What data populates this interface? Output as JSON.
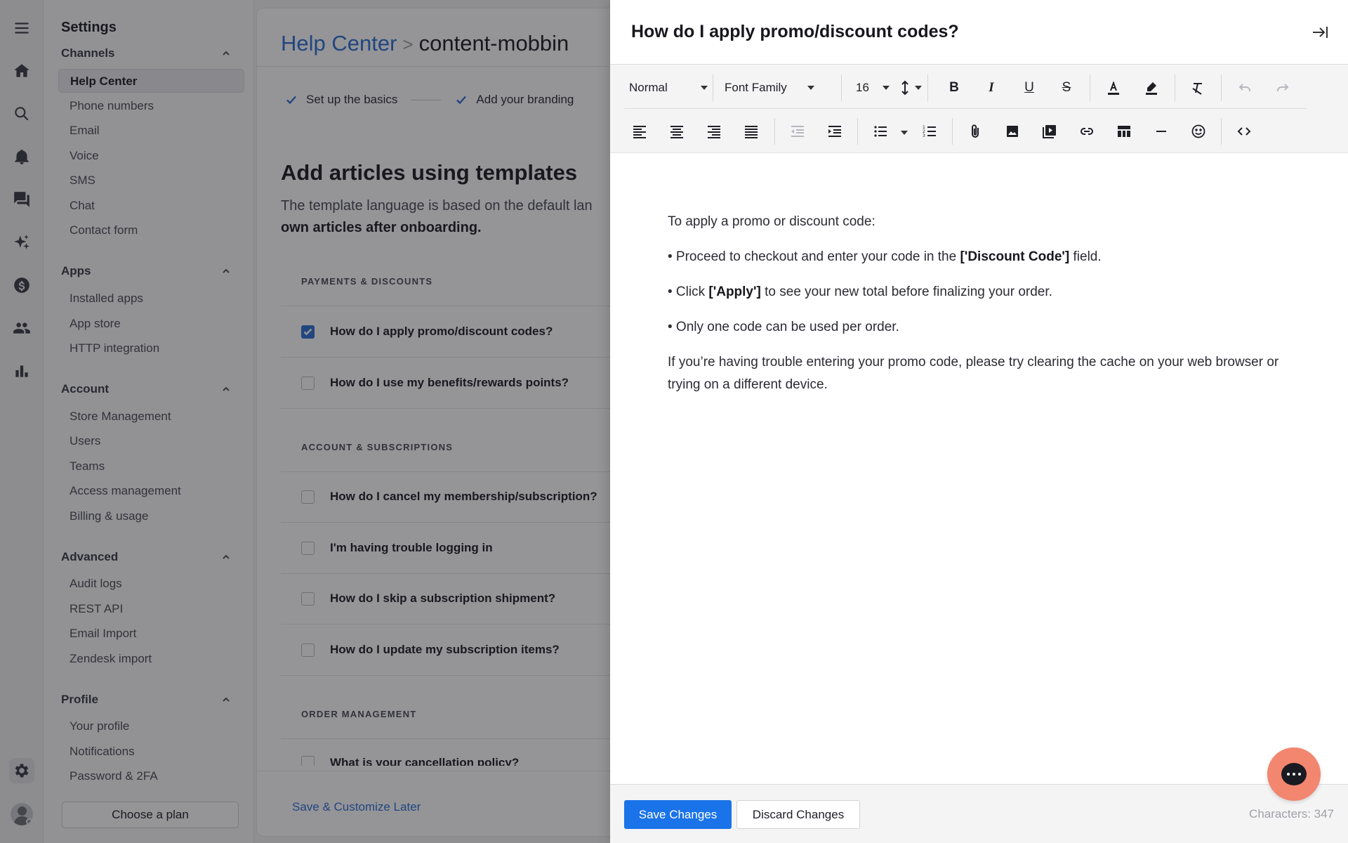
{
  "sidebar": {
    "title": "Settings",
    "sections": [
      {
        "label": "Channels",
        "items": [
          "Help Center",
          "Phone numbers",
          "Email",
          "Voice",
          "SMS",
          "Chat",
          "Contact form"
        ]
      },
      {
        "label": "Apps",
        "items": [
          "Installed apps",
          "App store",
          "HTTP integration"
        ]
      },
      {
        "label": "Account",
        "items": [
          "Store Management",
          "Users",
          "Teams",
          "Access management",
          "Billing & usage"
        ]
      },
      {
        "label": "Advanced",
        "items": [
          "Audit logs",
          "REST API",
          "Email Import",
          "Zendesk import"
        ]
      },
      {
        "label": "Profile",
        "items": [
          "Your profile",
          "Notifications",
          "Password & 2FA"
        ]
      }
    ],
    "active_item": "Help Center",
    "plan_button": "Choose a plan"
  },
  "breadcrumb": {
    "link": "Help Center",
    "separator": ">",
    "current": "content-mobbin"
  },
  "steps": [
    "Set up the basics",
    "Add your branding"
  ],
  "main": {
    "heading": "Add articles using templates",
    "description_normal": "The template language is based on the default lan",
    "description_bold": "own articles after onboarding.",
    "groups": [
      {
        "label": "PAYMENTS & DISCOUNTS",
        "articles": [
          {
            "title": "How do I apply promo/discount codes?",
            "checked": true
          },
          {
            "title": "How do I use my benefits/rewards points?",
            "checked": false
          }
        ]
      },
      {
        "label": "ACCOUNT & SUBSCRIPTIONS",
        "articles": [
          {
            "title": "How do I cancel my membership/subscription?",
            "checked": false
          },
          {
            "title": "I'm having trouble logging in",
            "checked": false
          },
          {
            "title": "How do I skip a subscription shipment?",
            "checked": false
          },
          {
            "title": "How do I update my subscription items?",
            "checked": false
          }
        ]
      },
      {
        "label": "ORDER MANAGEMENT",
        "articles": [
          {
            "title": "What is your cancellation policy?",
            "checked": false
          }
        ]
      }
    ],
    "save_later": "Save & Customize Later"
  },
  "panel": {
    "title": "How do I apply promo/discount codes?",
    "toolbar": {
      "paragraph_style": "Normal",
      "font_family": "Font Family",
      "font_size": "16"
    },
    "content": {
      "intro": "To apply a promo or discount code:",
      "b1_pre": "• Proceed to checkout and enter your code in the ",
      "b1_bold": "['Discount Code']",
      "b1_post": " field.",
      "b2_pre": "• Click ",
      "b2_bold": "['Apply']",
      "b2_post": " to see your new total before finalizing your order.",
      "b3": "• Only one code can be used per order.",
      "outro": "If you’re having trouble entering your promo code, please try clearing the cache on your web browser or trying on a different device."
    },
    "save_button": "Save Changes",
    "discard_button": "Discard Changes",
    "char_count": "Characters: 347"
  },
  "colors": {
    "accent": "#1a73e8",
    "link": "#2f6fd1",
    "chat": "#f2866f"
  }
}
